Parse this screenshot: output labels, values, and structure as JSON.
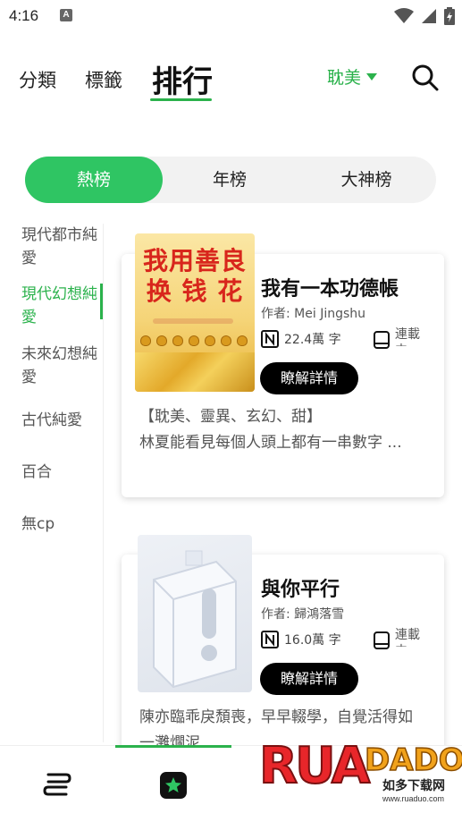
{
  "status_bar": {
    "time": "4:16",
    "notification_letter": "A"
  },
  "top_nav": {
    "tabs": [
      {
        "label": "分類",
        "active": false
      },
      {
        "label": "標籤",
        "active": false
      },
      {
        "label": "排行",
        "active": true
      }
    ],
    "genre_selector": "耽美",
    "search_icon": "search-icon"
  },
  "rank_switch": {
    "options": [
      {
        "label": "熱榜",
        "active": true
      },
      {
        "label": "年榜",
        "active": false
      },
      {
        "label": "大神榜",
        "active": false
      }
    ]
  },
  "categories": [
    {
      "label": "現代都市純愛",
      "active": false
    },
    {
      "label": "現代幻想純愛",
      "active": true
    },
    {
      "label": "未來幻想純愛",
      "active": false
    },
    {
      "label": "古代純愛",
      "active": false
    },
    {
      "label": "百合",
      "active": false
    },
    {
      "label": "無cp",
      "active": false
    }
  ],
  "books": [
    {
      "title": "我有一本功德帳",
      "author": "作者: Mei Jingshu",
      "word_count": "22.4萬 字",
      "status": "連載中",
      "detail_button": "瞭解詳情",
      "description": "【耽美、靈異、玄幻、甜】\n林夏能看見每個人頭上都有一串數字 ...",
      "cover_text": "我用善良换钱花"
    },
    {
      "title": "與你平行",
      "author": "作者: 歸鴻落雪",
      "word_count": "16.0萬 字",
      "status": "連載中",
      "detail_button": "瞭解詳情",
      "description": "陳亦臨乖戾頹喪，早早輟學，自覺活得如一灘爛泥"
    }
  ],
  "bottom_nav": {
    "items": [
      {
        "icon": "bookshelf-icon"
      },
      {
        "icon": "discover-star-icon"
      }
    ]
  },
  "watermark": {
    "logo": "RUANDUO",
    "cn": "如多下载网",
    "url": "www.ruaduo.com"
  },
  "colors": {
    "accent": "#2bb24c",
    "segment_active": "#2fc563",
    "button": "#000000"
  }
}
